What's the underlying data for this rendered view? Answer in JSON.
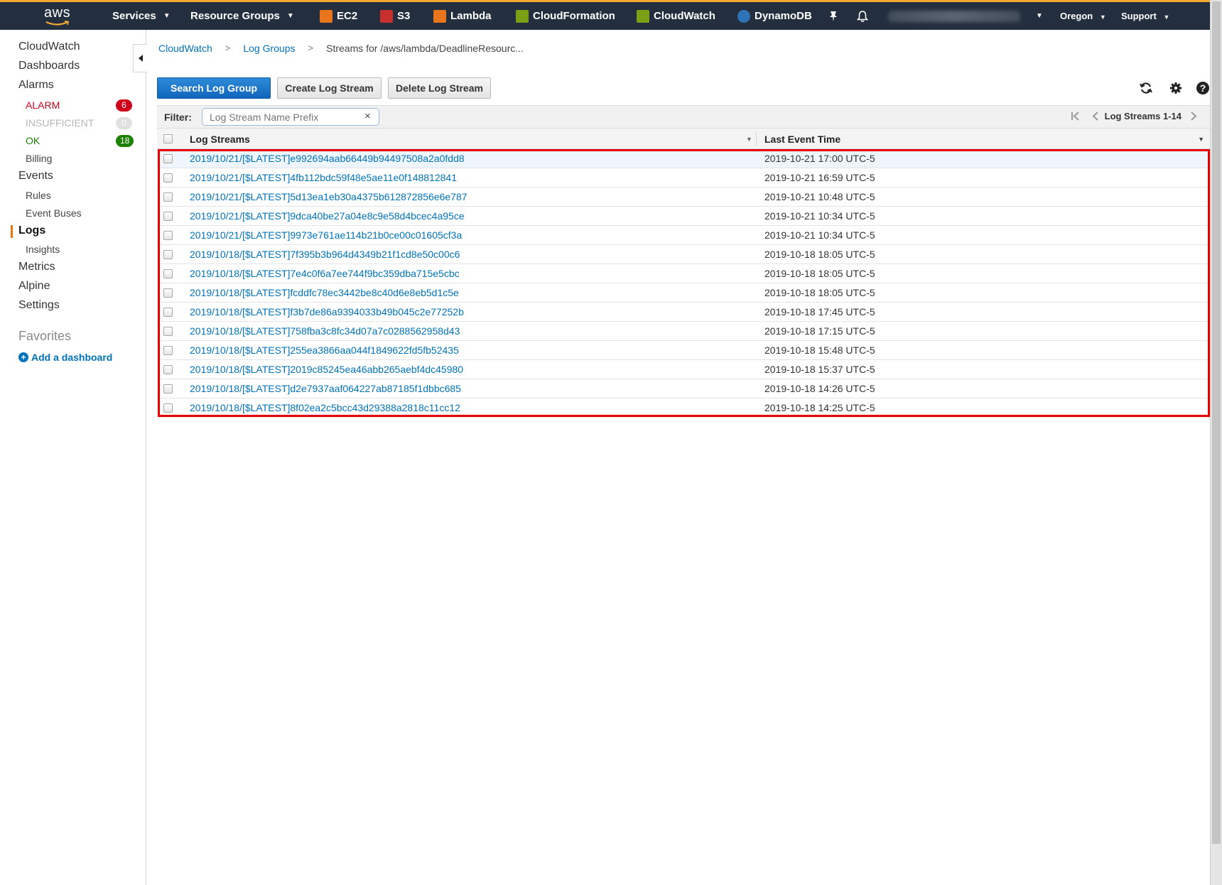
{
  "topnav": {
    "logo_text": "aws",
    "services": "Services",
    "resource_groups": "Resource Groups",
    "pinned": [
      {
        "label": "EC2",
        "icon": "ec2-icon",
        "color": "#e8741c"
      },
      {
        "label": "S3",
        "icon": "s3-icon",
        "color": "#c7302c"
      },
      {
        "label": "Lambda",
        "icon": "lambda-icon",
        "color": "#e8741c"
      },
      {
        "label": "CloudFormation",
        "icon": "cloudformation-icon",
        "color": "#7aa116"
      },
      {
        "label": "CloudWatch",
        "icon": "cloudwatch-icon",
        "color": "#7aa116"
      },
      {
        "label": "DynamoDB",
        "icon": "dynamodb-icon",
        "color": "#2e73b8"
      }
    ],
    "region": "Oregon",
    "support": "Support"
  },
  "sidebar": {
    "cloudwatch": "CloudWatch",
    "dashboards": "Dashboards",
    "alarms": "Alarms",
    "alarm": {
      "label": "ALARM",
      "count": "6"
    },
    "insufficient": {
      "label": "INSUFFICIENT",
      "count": "0"
    },
    "ok": {
      "label": "OK",
      "count": "18"
    },
    "billing": "Billing",
    "events": "Events",
    "rules": "Rules",
    "event_buses": "Event Buses",
    "logs": "Logs",
    "insights": "Insights",
    "metrics": "Metrics",
    "alpine": "Alpine",
    "settings": "Settings",
    "favorites": "Favorites",
    "add_dashboard": "Add a dashboard"
  },
  "breadcrumb": {
    "item1": "CloudWatch",
    "item2": "Log Groups",
    "current": "Streams for /aws/lambda/DeadlineResourc..."
  },
  "toolbar": {
    "search": "Search Log Group",
    "create": "Create Log Stream",
    "delete": "Delete Log Stream"
  },
  "filter": {
    "label": "Filter:",
    "placeholder": "Log Stream Name Prefix",
    "clear": "×",
    "pager": "Log Streams 1-14"
  },
  "table": {
    "col1": "Log Streams",
    "col2": "Last Event Time",
    "rows": [
      {
        "name": "2019/10/21/[$LATEST]e992694aab66449b94497508a2a0fdd8",
        "time": "2019-10-21 17:00 UTC-5"
      },
      {
        "name": "2019/10/21/[$LATEST]4fb112bdc59f48e5ae11e0f148812841",
        "time": "2019-10-21 16:59 UTC-5"
      },
      {
        "name": "2019/10/21/[$LATEST]5d13ea1eb30a4375b612872856e6e787",
        "time": "2019-10-21 10:48 UTC-5"
      },
      {
        "name": "2019/10/21/[$LATEST]9dca40be27a04e8c9e58d4bcec4a95ce",
        "time": "2019-10-21 10:34 UTC-5"
      },
      {
        "name": "2019/10/21/[$LATEST]9973e761ae114b21b0ce00c01605cf3a",
        "time": "2019-10-21 10:34 UTC-5"
      },
      {
        "name": "2019/10/18/[$LATEST]7f395b3b964d4349b21f1cd8e50c00c6",
        "time": "2019-10-18 18:05 UTC-5"
      },
      {
        "name": "2019/10/18/[$LATEST]7e4c0f6a7ee744f9bc359dba715e5cbc",
        "time": "2019-10-18 18:05 UTC-5"
      },
      {
        "name": "2019/10/18/[$LATEST]fcddfc78ec3442be8c40d6e8eb5d1c5e",
        "time": "2019-10-18 18:05 UTC-5"
      },
      {
        "name": "2019/10/18/[$LATEST]f3b7de86a9394033b49b045c2e77252b",
        "time": "2019-10-18 17:45 UTC-5"
      },
      {
        "name": "2019/10/18/[$LATEST]758fba3c8fc34d07a7c0288562958d43",
        "time": "2019-10-18 17:15 UTC-5"
      },
      {
        "name": "2019/10/18/[$LATEST]255ea3866aa044f1849622fd5fb52435",
        "time": "2019-10-18 15:48 UTC-5"
      },
      {
        "name": "2019/10/18/[$LATEST]2019c85245ea46abb265aebf4dc45980",
        "time": "2019-10-18 15:37 UTC-5"
      },
      {
        "name": "2019/10/18/[$LATEST]d2e7937aaf064227ab87185f1dbbc685",
        "time": "2019-10-18 14:26 UTC-5"
      },
      {
        "name": "2019/10/18/[$LATEST]8f02ea2c5bcc43d29388a2818c11cc12",
        "time": "2019-10-18 14:25 UTC-5"
      }
    ]
  }
}
